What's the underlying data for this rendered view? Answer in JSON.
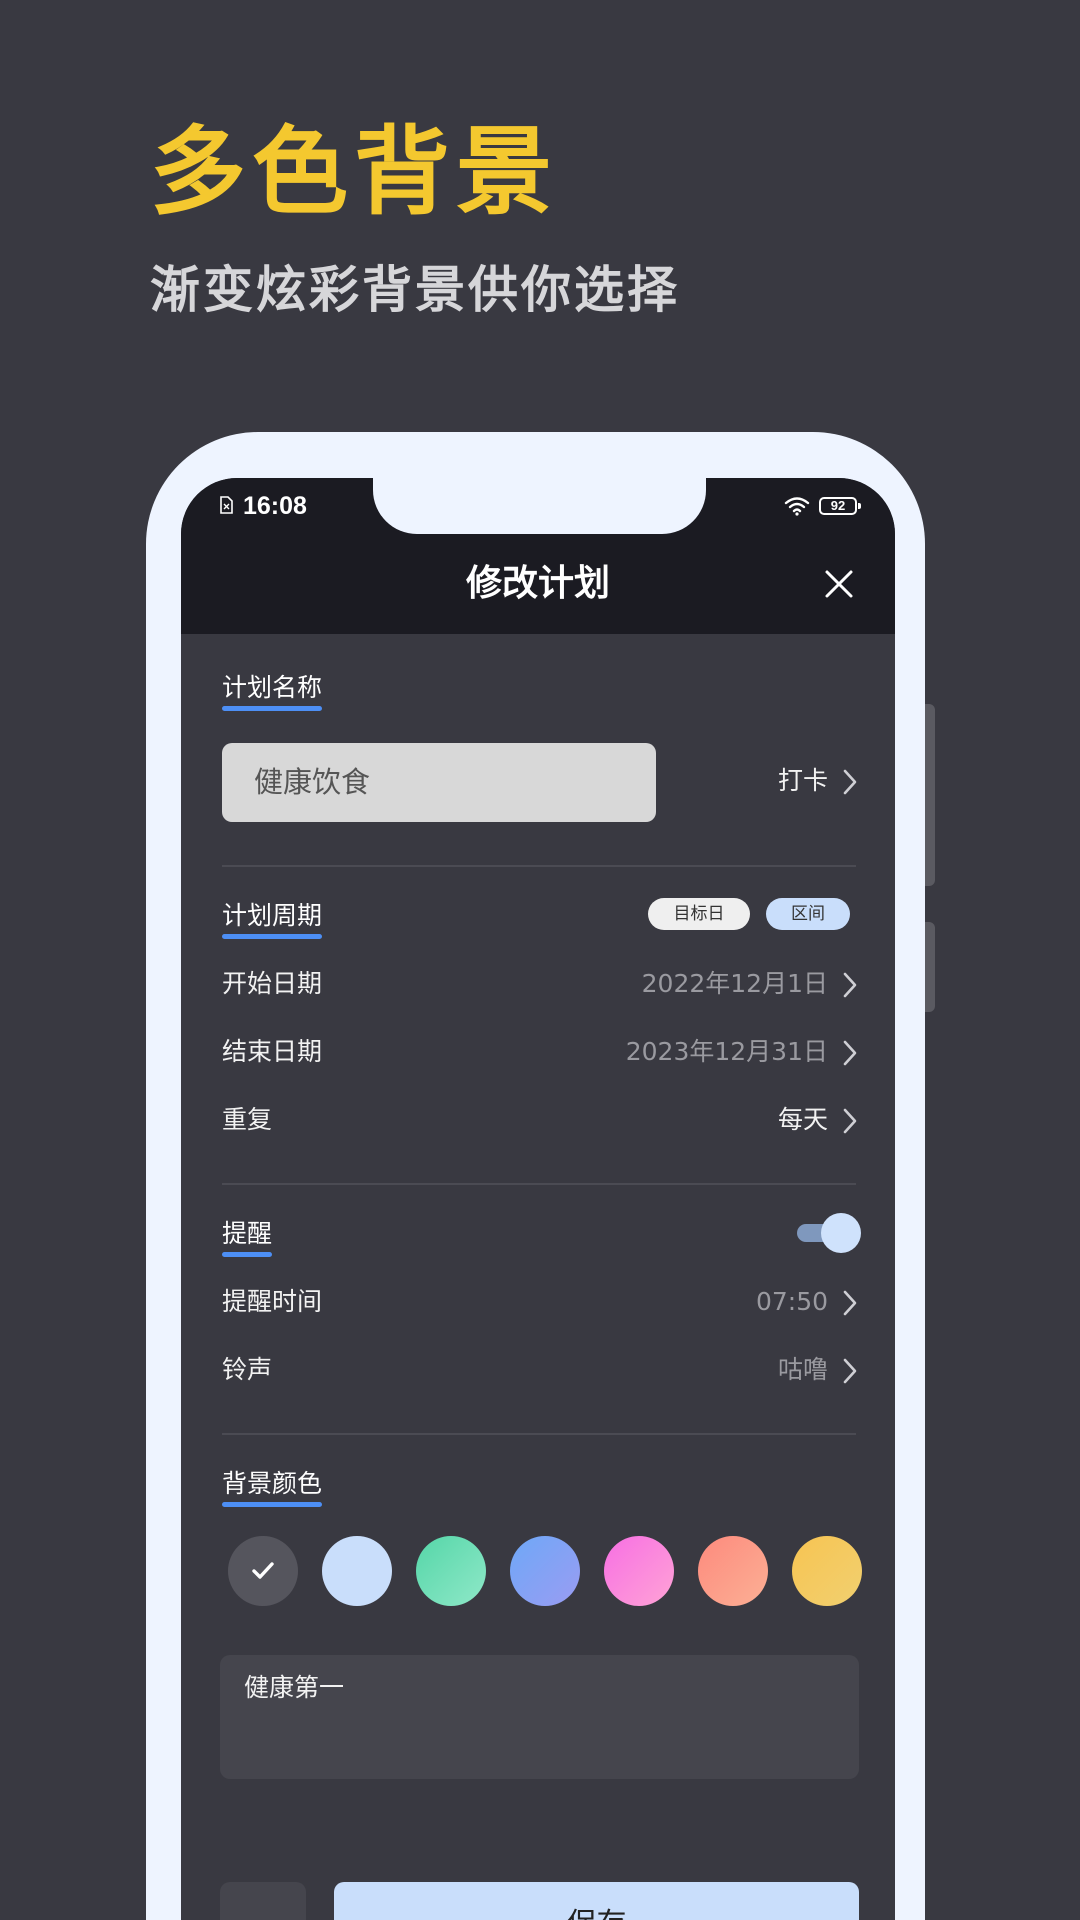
{
  "promo": {
    "title": "多色背景",
    "subtitle": "渐变炫彩背景供你选择"
  },
  "status_bar": {
    "time": "16:08",
    "battery": "92",
    "icons": [
      "sim-icon",
      "wifi-icon",
      "battery-icon"
    ]
  },
  "header": {
    "title": "修改计划",
    "close_icon": "close-icon"
  },
  "plan_name": {
    "section_label": "计划名称",
    "input_value": "健康饮食",
    "type_value": "打卡"
  },
  "period": {
    "section_label": "计划周期",
    "pill_target": "目标日",
    "pill_range": "区间",
    "start_label": "开始日期",
    "start_value": "2022年12月1日",
    "end_label": "结束日期",
    "end_value": "2023年12月31日",
    "repeat_label": "重复",
    "repeat_value": "每天"
  },
  "reminder": {
    "section_label": "提醒",
    "enabled": true,
    "time_label": "提醒时间",
    "time_value": "07:50",
    "ringtone_label": "铃声",
    "ringtone_value": "咕噜"
  },
  "background_color": {
    "section_label": "背景颜色",
    "selected_index": 0,
    "swatches": [
      {
        "name": "dark",
        "colors": [
          "#55555d",
          "#55555d"
        ]
      },
      {
        "name": "light-blue",
        "colors": [
          "#c9defb",
          "#c9defb"
        ]
      },
      {
        "name": "green",
        "colors": [
          "#55d6a8",
          "#8fe8c8"
        ]
      },
      {
        "name": "blue-purple",
        "colors": [
          "#6ea8f7",
          "#9a9cf2"
        ]
      },
      {
        "name": "pink",
        "colors": [
          "#f76fe3",
          "#ffa3d6"
        ]
      },
      {
        "name": "coral",
        "colors": [
          "#fd8a7d",
          "#fcb095"
        ]
      },
      {
        "name": "yellow",
        "colors": [
          "#f7c452",
          "#f1d070"
        ]
      }
    ]
  },
  "note": {
    "value": "健康第一"
  },
  "actions": {
    "save_label": "保存",
    "delete_icon": "trash-icon"
  },
  "colors": {
    "page_bg": "#393941",
    "accent_yellow": "#f4c82f",
    "accent_blue": "#4d8ff5",
    "header_bg": "#1b1b22",
    "phone_frame": "#eef4ff"
  }
}
